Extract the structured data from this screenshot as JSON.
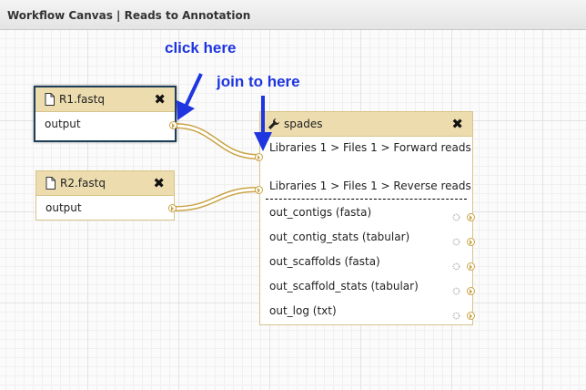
{
  "window": {
    "title": "Workflow Canvas | Reads to Annotation"
  },
  "annotations": {
    "click_here": "click here",
    "join_to_here": "join to here",
    "arrow_color": "#1e35e0"
  },
  "nodes": {
    "r1": {
      "title": "R1.fastq",
      "output_label": "output",
      "file_icon": "file-icon",
      "close_icon": "close-icon"
    },
    "r2": {
      "title": "R2.fastq",
      "output_label": "output",
      "file_icon": "file-icon",
      "close_icon": "close-icon"
    },
    "spades": {
      "title": "spades",
      "tool_icon": "wrench-icon",
      "close_icon": "close-icon",
      "inputs": [
        "Libraries 1 > Files 1 > Forward reads",
        "Libraries 1 > Files 1 > Reverse reads"
      ],
      "outputs": [
        "out_contigs (fasta)",
        "out_contig_stats (tabular)",
        "out_scaffolds (fasta)",
        "out_scaffold_stats (tabular)",
        "out_log (txt)"
      ]
    }
  },
  "colors": {
    "node_header": "#ecdcae",
    "node_border": "#d7c48a",
    "selected_border": "#1e3f57",
    "connector": "#c9a445"
  }
}
